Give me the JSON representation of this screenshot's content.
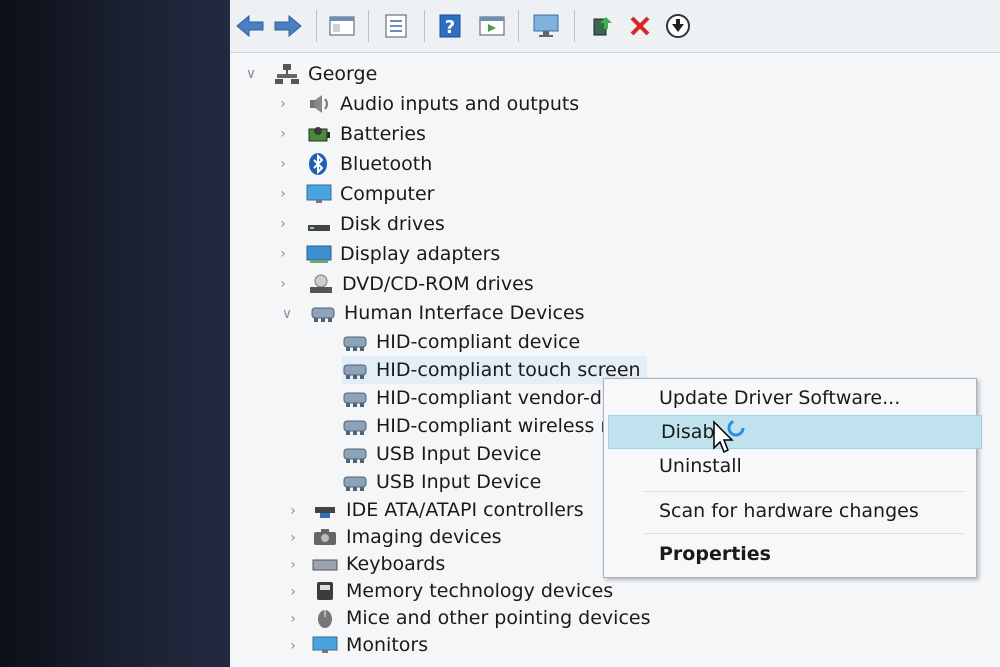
{
  "tree": {
    "root": "George",
    "categories": [
      "Audio inputs and outputs",
      "Batteries",
      "Bluetooth",
      "Computer",
      "Disk drives",
      "Display adapters",
      "DVD/CD-ROM drives",
      "Human Interface Devices",
      "IDE ATA/ATAPI controllers",
      "Imaging devices",
      "Keyboards",
      "Memory technology devices",
      "Mice and other pointing devices",
      "Monitors"
    ],
    "hid_children": [
      "HID-compliant device",
      "HID-compliant touch screen",
      "HID-compliant vendor-de",
      "HID-compliant wireless ra",
      "USB Input Device",
      "USB Input Device"
    ]
  },
  "context_menu": {
    "update": "Update Driver Software...",
    "disable": "Disabl",
    "uninstall": "Uninstall",
    "scan": "Scan for hardware changes",
    "properties": "Properties"
  }
}
